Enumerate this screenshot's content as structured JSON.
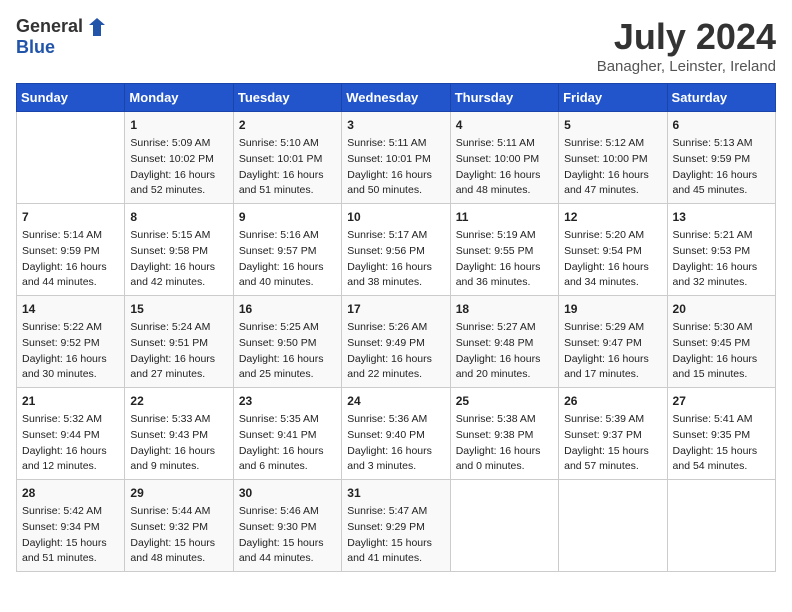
{
  "header": {
    "logo_line1": "General",
    "logo_line2": "Blue",
    "month_year": "July 2024",
    "location": "Banagher, Leinster, Ireland"
  },
  "columns": [
    "Sunday",
    "Monday",
    "Tuesday",
    "Wednesday",
    "Thursday",
    "Friday",
    "Saturday"
  ],
  "weeks": [
    [
      {
        "day": "",
        "lines": []
      },
      {
        "day": "1",
        "lines": [
          "Sunrise: 5:09 AM",
          "Sunset: 10:02 PM",
          "Daylight: 16 hours",
          "and 52 minutes."
        ]
      },
      {
        "day": "2",
        "lines": [
          "Sunrise: 5:10 AM",
          "Sunset: 10:01 PM",
          "Daylight: 16 hours",
          "and 51 minutes."
        ]
      },
      {
        "day": "3",
        "lines": [
          "Sunrise: 5:11 AM",
          "Sunset: 10:01 PM",
          "Daylight: 16 hours",
          "and 50 minutes."
        ]
      },
      {
        "day": "4",
        "lines": [
          "Sunrise: 5:11 AM",
          "Sunset: 10:00 PM",
          "Daylight: 16 hours",
          "and 48 minutes."
        ]
      },
      {
        "day": "5",
        "lines": [
          "Sunrise: 5:12 AM",
          "Sunset: 10:00 PM",
          "Daylight: 16 hours",
          "and 47 minutes."
        ]
      },
      {
        "day": "6",
        "lines": [
          "Sunrise: 5:13 AM",
          "Sunset: 9:59 PM",
          "Daylight: 16 hours",
          "and 45 minutes."
        ]
      }
    ],
    [
      {
        "day": "7",
        "lines": [
          "Sunrise: 5:14 AM",
          "Sunset: 9:59 PM",
          "Daylight: 16 hours",
          "and 44 minutes."
        ]
      },
      {
        "day": "8",
        "lines": [
          "Sunrise: 5:15 AM",
          "Sunset: 9:58 PM",
          "Daylight: 16 hours",
          "and 42 minutes."
        ]
      },
      {
        "day": "9",
        "lines": [
          "Sunrise: 5:16 AM",
          "Sunset: 9:57 PM",
          "Daylight: 16 hours",
          "and 40 minutes."
        ]
      },
      {
        "day": "10",
        "lines": [
          "Sunrise: 5:17 AM",
          "Sunset: 9:56 PM",
          "Daylight: 16 hours",
          "and 38 minutes."
        ]
      },
      {
        "day": "11",
        "lines": [
          "Sunrise: 5:19 AM",
          "Sunset: 9:55 PM",
          "Daylight: 16 hours",
          "and 36 minutes."
        ]
      },
      {
        "day": "12",
        "lines": [
          "Sunrise: 5:20 AM",
          "Sunset: 9:54 PM",
          "Daylight: 16 hours",
          "and 34 minutes."
        ]
      },
      {
        "day": "13",
        "lines": [
          "Sunrise: 5:21 AM",
          "Sunset: 9:53 PM",
          "Daylight: 16 hours",
          "and 32 minutes."
        ]
      }
    ],
    [
      {
        "day": "14",
        "lines": [
          "Sunrise: 5:22 AM",
          "Sunset: 9:52 PM",
          "Daylight: 16 hours",
          "and 30 minutes."
        ]
      },
      {
        "day": "15",
        "lines": [
          "Sunrise: 5:24 AM",
          "Sunset: 9:51 PM",
          "Daylight: 16 hours",
          "and 27 minutes."
        ]
      },
      {
        "day": "16",
        "lines": [
          "Sunrise: 5:25 AM",
          "Sunset: 9:50 PM",
          "Daylight: 16 hours",
          "and 25 minutes."
        ]
      },
      {
        "day": "17",
        "lines": [
          "Sunrise: 5:26 AM",
          "Sunset: 9:49 PM",
          "Daylight: 16 hours",
          "and 22 minutes."
        ]
      },
      {
        "day": "18",
        "lines": [
          "Sunrise: 5:27 AM",
          "Sunset: 9:48 PM",
          "Daylight: 16 hours",
          "and 20 minutes."
        ]
      },
      {
        "day": "19",
        "lines": [
          "Sunrise: 5:29 AM",
          "Sunset: 9:47 PM",
          "Daylight: 16 hours",
          "and 17 minutes."
        ]
      },
      {
        "day": "20",
        "lines": [
          "Sunrise: 5:30 AM",
          "Sunset: 9:45 PM",
          "Daylight: 16 hours",
          "and 15 minutes."
        ]
      }
    ],
    [
      {
        "day": "21",
        "lines": [
          "Sunrise: 5:32 AM",
          "Sunset: 9:44 PM",
          "Daylight: 16 hours",
          "and 12 minutes."
        ]
      },
      {
        "day": "22",
        "lines": [
          "Sunrise: 5:33 AM",
          "Sunset: 9:43 PM",
          "Daylight: 16 hours",
          "and 9 minutes."
        ]
      },
      {
        "day": "23",
        "lines": [
          "Sunrise: 5:35 AM",
          "Sunset: 9:41 PM",
          "Daylight: 16 hours",
          "and 6 minutes."
        ]
      },
      {
        "day": "24",
        "lines": [
          "Sunrise: 5:36 AM",
          "Sunset: 9:40 PM",
          "Daylight: 16 hours",
          "and 3 minutes."
        ]
      },
      {
        "day": "25",
        "lines": [
          "Sunrise: 5:38 AM",
          "Sunset: 9:38 PM",
          "Daylight: 16 hours",
          "and 0 minutes."
        ]
      },
      {
        "day": "26",
        "lines": [
          "Sunrise: 5:39 AM",
          "Sunset: 9:37 PM",
          "Daylight: 15 hours",
          "and 57 minutes."
        ]
      },
      {
        "day": "27",
        "lines": [
          "Sunrise: 5:41 AM",
          "Sunset: 9:35 PM",
          "Daylight: 15 hours",
          "and 54 minutes."
        ]
      }
    ],
    [
      {
        "day": "28",
        "lines": [
          "Sunrise: 5:42 AM",
          "Sunset: 9:34 PM",
          "Daylight: 15 hours",
          "and 51 minutes."
        ]
      },
      {
        "day": "29",
        "lines": [
          "Sunrise: 5:44 AM",
          "Sunset: 9:32 PM",
          "Daylight: 15 hours",
          "and 48 minutes."
        ]
      },
      {
        "day": "30",
        "lines": [
          "Sunrise: 5:46 AM",
          "Sunset: 9:30 PM",
          "Daylight: 15 hours",
          "and 44 minutes."
        ]
      },
      {
        "day": "31",
        "lines": [
          "Sunrise: 5:47 AM",
          "Sunset: 9:29 PM",
          "Daylight: 15 hours",
          "and 41 minutes."
        ]
      },
      {
        "day": "",
        "lines": []
      },
      {
        "day": "",
        "lines": []
      },
      {
        "day": "",
        "lines": []
      }
    ]
  ]
}
